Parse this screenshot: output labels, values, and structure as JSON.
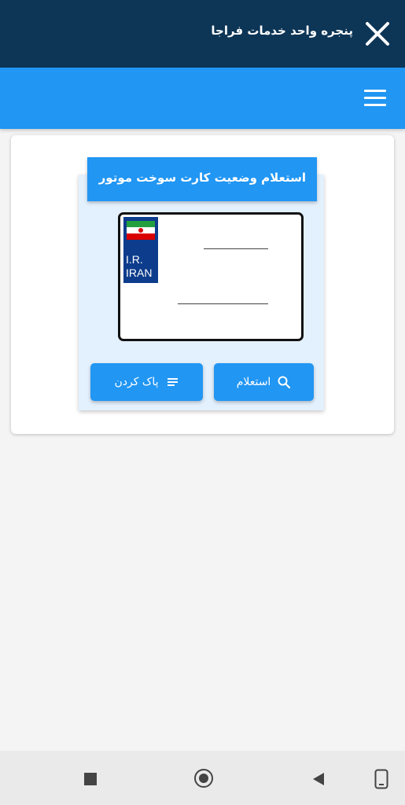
{
  "window": {
    "title": "پنجره واحد خدمات فراجا"
  },
  "panel": {
    "title": "استعلام وضعیت کارت سوخت موتور"
  },
  "plate": {
    "country_line1": "I.R.",
    "country_line2": "IRAN"
  },
  "buttons": {
    "inquiry_label": "استعلام",
    "clear_label": "پاک کردن"
  },
  "colors": {
    "topbar": "#0d3556",
    "accent": "#2196f3",
    "panel_bg": "#e3f0fd",
    "plate_strip": "#0d3c8c"
  },
  "icons": [
    "close-icon",
    "menu-icon",
    "search-icon",
    "clear-lines-icon",
    "iran-flag-icon",
    "recent-apps-icon",
    "home-icon",
    "back-icon",
    "screen-rotate-icon"
  ]
}
